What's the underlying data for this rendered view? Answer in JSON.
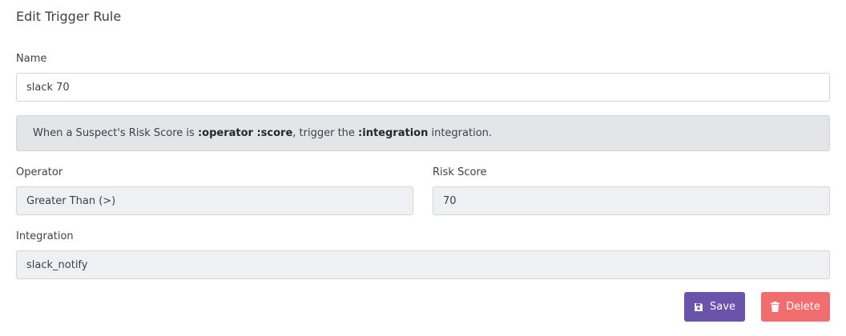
{
  "form": {
    "title": "Edit Trigger Rule",
    "name_label": "Name",
    "name_value": "slack 70",
    "description": {
      "prefix": "When a Suspect's Risk Score is ",
      "operator_token": ":operator",
      "space": " ",
      "score_token": ":score",
      "middle": ", trigger the ",
      "integration_token": ":integration",
      "suffix": " integration."
    },
    "operator_label": "Operator",
    "operator_value": "Greater Than (>)",
    "risk_score_label": "Risk Score",
    "risk_score_value": "70",
    "integration_label": "Integration",
    "integration_value": "slack_notify"
  },
  "actions": {
    "save_label": "Save",
    "save_icon": "floppy-disk-icon",
    "delete_label": "Delete",
    "delete_icon": "trash-icon"
  },
  "colors": {
    "save_button": "#6b52ab",
    "delete_button": "#f26d6d",
    "banner_bg": "#e4e5e8",
    "readonly_field_bg": "#eef0f4"
  }
}
